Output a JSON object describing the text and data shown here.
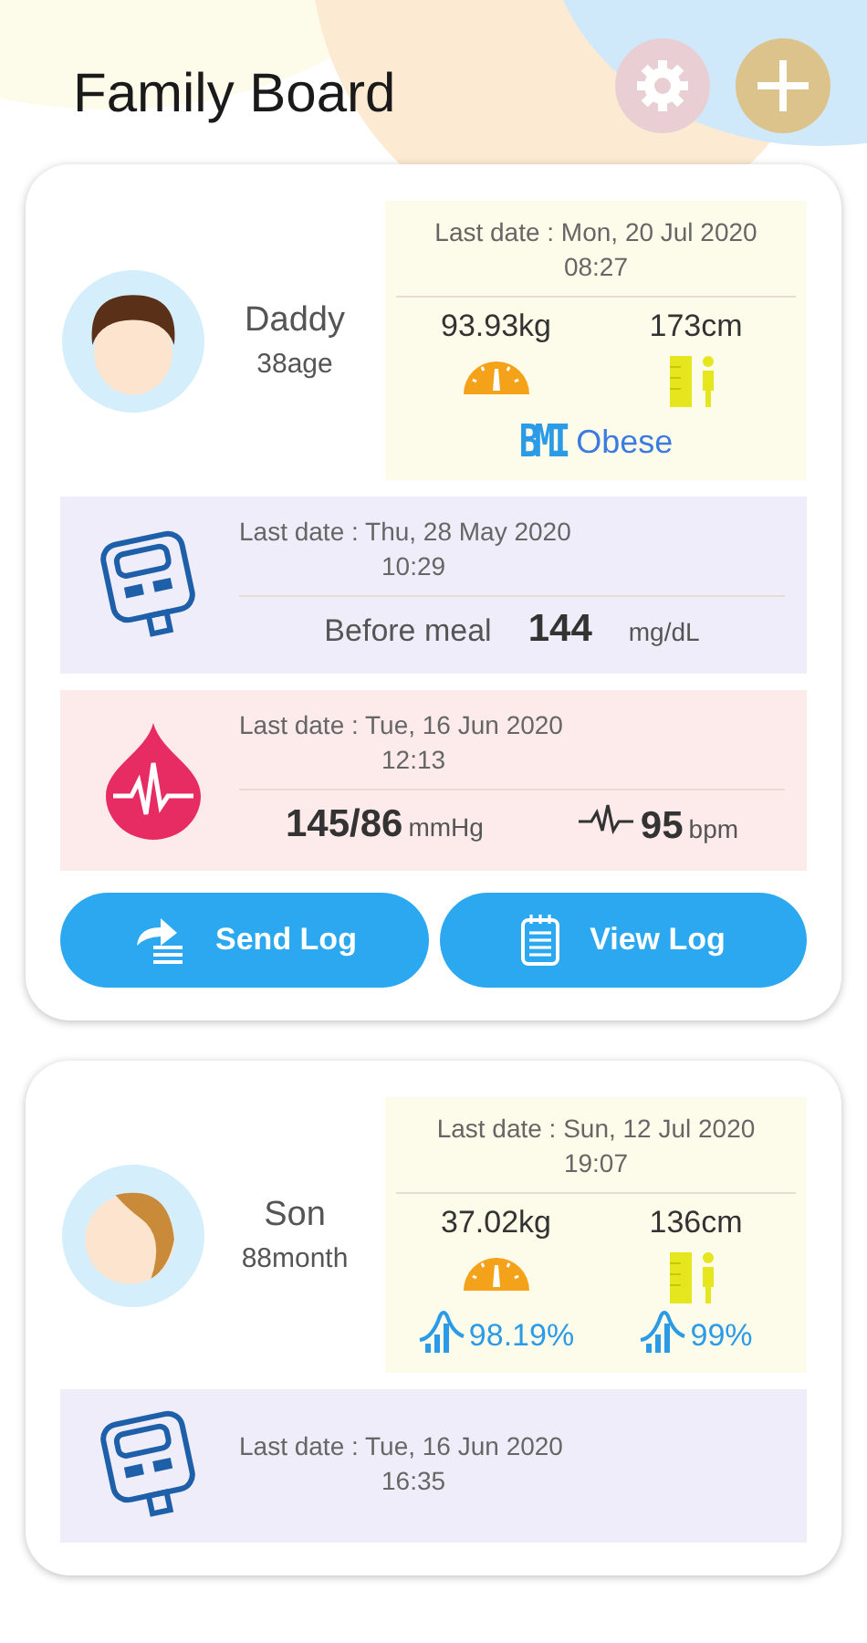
{
  "header": {
    "title": "Family Board"
  },
  "members": [
    {
      "name": "Daddy",
      "age": "38age",
      "avatar": {
        "kind": "adult"
      },
      "body": {
        "date": "Last date : Mon, 20 Jul 2020",
        "time": "08:27",
        "weight": "93.93kg",
        "height": "173cm",
        "kind": "bmi",
        "bmi_label": "BMI",
        "bmi": "Obese"
      },
      "glucose": {
        "date": "Last date : Thu, 28 May 2020",
        "time": "10:29",
        "meal": "Before meal",
        "value": "144",
        "unit": "mg/dL"
      },
      "pressure": {
        "date": "Last date : Tue, 16 Jun 2020",
        "time": "12:13",
        "value": "145/86",
        "unit": "mmHg",
        "pulse": "95",
        "pulse_unit": "bpm"
      },
      "buttons": [
        "Send Log",
        "View Log"
      ]
    },
    {
      "name": "Son",
      "age": "88month",
      "avatar": {
        "kind": "child"
      },
      "body": {
        "date": "Last date : Sun, 12 Jul 2020",
        "time": "19:07",
        "weight": "37.02kg",
        "height": "136cm",
        "kind": "percentile",
        "weight_percentile": "98.19%",
        "height_percentile": "99%"
      },
      "glucose": {
        "date": "Last date : Tue, 16 Jun 2020",
        "time": "16:35"
      }
    }
  ]
}
